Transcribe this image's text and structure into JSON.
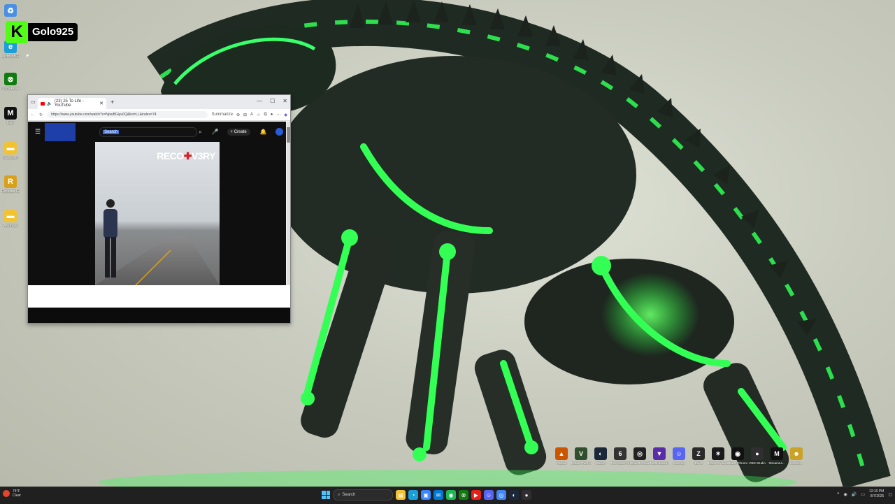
{
  "overlay": {
    "badge_letter": "K",
    "streamer_name": "Golo925"
  },
  "desktop_icons": [
    {
      "name": "recycle-bin-icon",
      "label": "",
      "color": "#4a90e2"
    },
    {
      "name": "microsoft-edge-icon",
      "label": "Microsoft Edge",
      "color": "#1a9fd8"
    },
    {
      "name": "xbox-app-icon",
      "label": "Xbox Ariva",
      "color": "#107c10"
    },
    {
      "name": "epic-games-icon",
      "label": "Epic",
      "color": "#111111"
    },
    {
      "name": "folder-icon",
      "label": "Golo_RB",
      "color": "#f1c232"
    },
    {
      "name": "rockstar-icon",
      "label": "Rockstar Games",
      "color": "#d9a01c"
    },
    {
      "name": "folder-icon-2",
      "label": "Alternate",
      "color": "#f1c232"
    }
  ],
  "browser": {
    "tab_title": "(23) 25 To Life - YouTube",
    "new_tab": "+",
    "url": "https://www.youtube.com/watch?v=NpiuBGiyu0Q&list=LL&index=74",
    "summarize": "Summarize",
    "win_min": "—",
    "win_max": "☐",
    "win_close": "✕"
  },
  "youtube": {
    "search_value": "Search",
    "create_label": "Create",
    "video_album_title": {
      "pre": "RECO",
      "mid": "✚",
      "post": "V3RY"
    }
  },
  "shelf_apps": [
    {
      "name": "fallout-app-icon",
      "label": "Fallout",
      "color": "#cc5500",
      "glyph": "▲"
    },
    {
      "name": "grand-theft-app-icon",
      "label": "Grand Theft Auto V Ent...",
      "color": "#2f4f2f",
      "glyph": "V"
    },
    {
      "name": "steam-app-icon",
      "label": "Steam",
      "color": "#1b2838",
      "glyph": "◐"
    },
    {
      "name": "rainbow-six-app-icon",
      "label": "Tom Clancy's Rainbow Si...",
      "color": "#333333",
      "glyph": "6"
    },
    {
      "name": "ubisoft-app-icon",
      "label": "Ubisoft Connect",
      "color": "#222222",
      "glyph": "◎"
    },
    {
      "name": "turtle-beach-app-icon",
      "label": "Turtle Beach Swarm II",
      "color": "#5a2da8",
      "glyph": "▼"
    },
    {
      "name": "discord-app-icon",
      "label": "Discord",
      "color": "#5865f2",
      "glyph": "☺"
    },
    {
      "name": "dayz-app-icon",
      "label": "DayZ",
      "color": "#2b2b2b",
      "glyph": "Z"
    },
    {
      "name": "razer-synapse-app-icon",
      "label": "Razer Synapse",
      "color": "#1b1b1b",
      "glyph": "✶"
    },
    {
      "name": "razer-chroma-app-icon",
      "label": "Razer Chroma",
      "color": "#111111",
      "glyph": "◉"
    },
    {
      "name": "obs-studio-app-icon",
      "label": "OBS Studio",
      "color": "#302e31",
      "glyph": "●"
    },
    {
      "name": "streamlabs-app-icon",
      "label": "StreamLa...",
      "color": "#111111",
      "glyph": "M"
    },
    {
      "name": "kick-app-icon",
      "label": "Kick Bo...",
      "color": "#c9a227",
      "glyph": "☻"
    }
  ],
  "taskbar": {
    "weather_temp": "74°F",
    "weather_desc": "Clear",
    "search_placeholder": "Search",
    "apps": [
      {
        "name": "file-explorer-icon",
        "color": "#f1c232",
        "glyph": "▤"
      },
      {
        "name": "edge-taskbar-icon",
        "color": "#1a9fd8",
        "glyph": "◔"
      },
      {
        "name": "store-icon",
        "color": "#3a86ff",
        "glyph": "▣"
      },
      {
        "name": "mail-icon",
        "color": "#0078d4",
        "glyph": "✉"
      },
      {
        "name": "spotify-icon",
        "color": "#1db954",
        "glyph": "◉"
      },
      {
        "name": "xbox-icon",
        "color": "#107c10",
        "glyph": "⊗"
      },
      {
        "name": "youtube-taskbar-icon",
        "color": "#e62117",
        "glyph": "▶"
      },
      {
        "name": "discord-taskbar-icon",
        "color": "#5865f2",
        "glyph": "☺"
      },
      {
        "name": "chrome-icon",
        "color": "#4285f4",
        "glyph": "◎"
      },
      {
        "name": "steam-taskbar-icon",
        "color": "#1b2838",
        "glyph": "◐"
      },
      {
        "name": "obs-taskbar-icon",
        "color": "#302e31",
        "glyph": "●"
      }
    ],
    "time": "12:10 PM",
    "date": "8/7/2025"
  }
}
